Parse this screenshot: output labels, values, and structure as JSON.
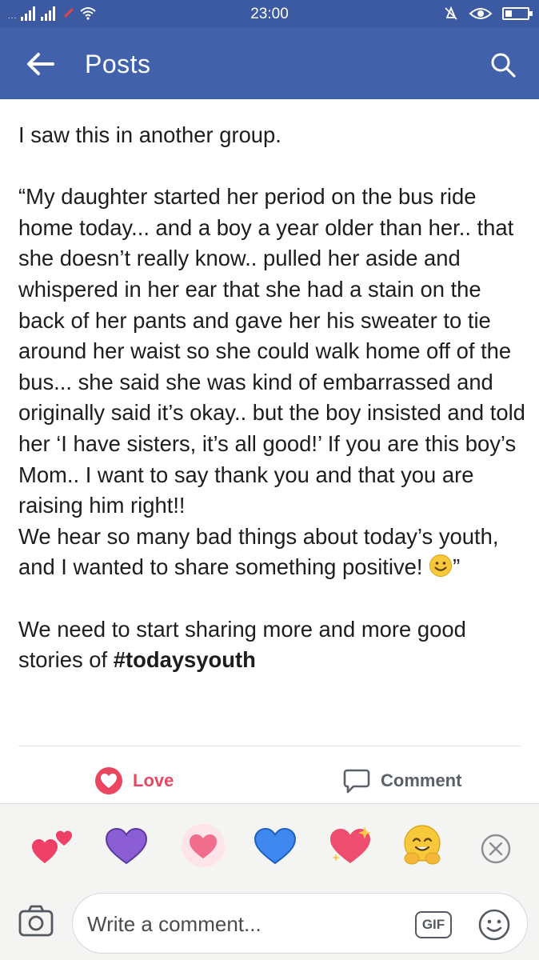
{
  "status_bar": {
    "time": "23:00",
    "left_glyph": "...",
    "icons": [
      "signal-icon",
      "signal-icon",
      "data-icon",
      "wifi-icon",
      "alarm-off-icon",
      "eye-icon",
      "battery-icon"
    ]
  },
  "app_bar": {
    "title": "Posts",
    "back_icon": "arrow-left-icon",
    "search_icon": "search-icon",
    "background": "#4162ab"
  },
  "post": {
    "paragraphs": [
      "I saw this in another group.",
      "“My daughter started her period on the bus ride home today... and a boy a year older than her.. that she doesn’t really know.. pulled her aside and whispered in her ear that she had a stain on the back of her pants and gave her his sweater to tie around her waist so she could walk home off of the bus... she said she was kind of embarrassed and originally said it’s okay.. but the boy insisted and told her ‘I have sisters, it’s all good!’ If you are this boy’s Mom.. I want to say thank you and that you are raising him right!!",
      "We hear so many bad things about today’s youth, and I wanted to share something positive!",
      "”",
      "We need to start sharing more and more good stories of",
      "#todaysyouth"
    ]
  },
  "actions": {
    "love_label": "Love",
    "comment_label": "Comment",
    "love_color": "#e8475f"
  },
  "reactions": [
    "two-hearts-icon",
    "purple-heart-icon",
    "glowing-heart-icon",
    "blue-heart-icon",
    "sparkling-heart-icon",
    "hugging-face-icon"
  ],
  "composer": {
    "placeholder": "Write a comment...",
    "gif_label": "GIF"
  }
}
